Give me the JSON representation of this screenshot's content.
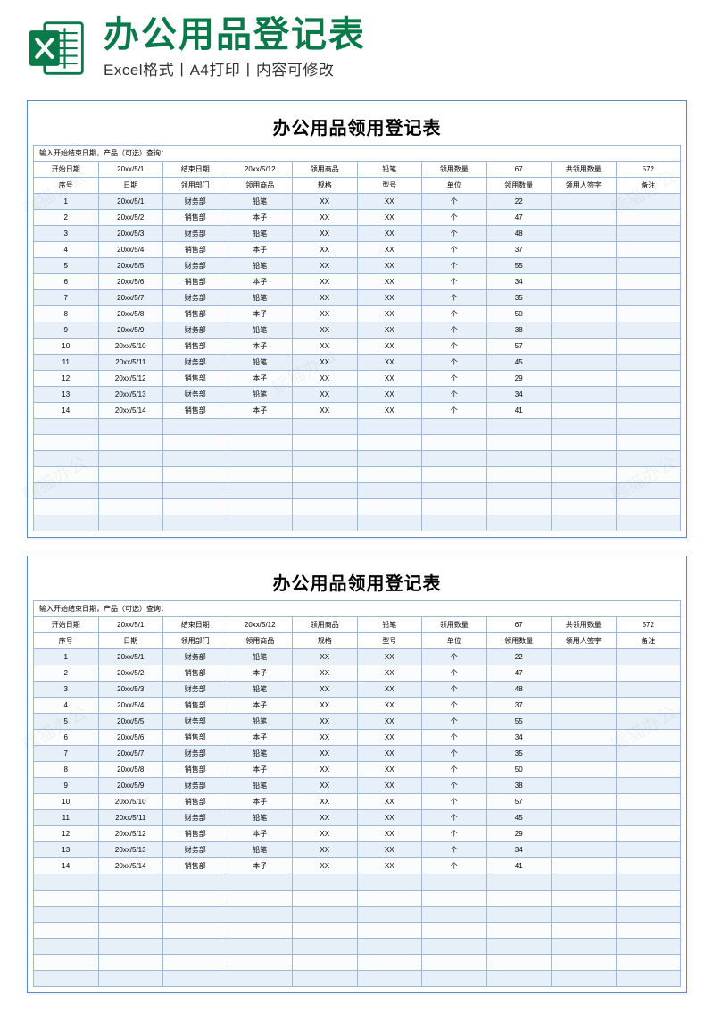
{
  "header": {
    "title": "办公用品登记表",
    "subtitle": "Excel格式丨A4打印丨内容可修改",
    "icon_name": "excel-icon"
  },
  "watermark": "熊猫办公",
  "doc": {
    "title": "办公用品领用登记表",
    "query_label": "输入开始结束日期，产品（可选）查询：",
    "filter": {
      "start_label": "开始日期",
      "start_val": "20xx/5/1",
      "end_label": "结束日期",
      "end_val": "20xx/5/12",
      "product_label": "领用商品",
      "product_val": "铅笔",
      "qty_label": "领用数量",
      "qty_val": "67",
      "total_label": "共领用数量",
      "total_val": "572"
    },
    "columns": [
      "序号",
      "日期",
      "领用部门",
      "领用商品",
      "规格",
      "型号",
      "单位",
      "领用数量",
      "领用人签字",
      "备注"
    ],
    "rows": [
      {
        "no": "1",
        "date": "20xx/5/1",
        "dept": "财务部",
        "item": "铅笔",
        "spec": "XX",
        "model": "XX",
        "unit": "个",
        "qty": "22",
        "sign": "",
        "note": ""
      },
      {
        "no": "2",
        "date": "20xx/5/2",
        "dept": "销售部",
        "item": "本子",
        "spec": "XX",
        "model": "XX",
        "unit": "个",
        "qty": "47",
        "sign": "",
        "note": ""
      },
      {
        "no": "3",
        "date": "20xx/5/3",
        "dept": "财务部",
        "item": "铅笔",
        "spec": "XX",
        "model": "XX",
        "unit": "个",
        "qty": "48",
        "sign": "",
        "note": ""
      },
      {
        "no": "4",
        "date": "20xx/5/4",
        "dept": "销售部",
        "item": "本子",
        "spec": "XX",
        "model": "XX",
        "unit": "个",
        "qty": "37",
        "sign": "",
        "note": ""
      },
      {
        "no": "5",
        "date": "20xx/5/5",
        "dept": "财务部",
        "item": "铅笔",
        "spec": "XX",
        "model": "XX",
        "unit": "个",
        "qty": "55",
        "sign": "",
        "note": ""
      },
      {
        "no": "6",
        "date": "20xx/5/6",
        "dept": "销售部",
        "item": "本子",
        "spec": "XX",
        "model": "XX",
        "unit": "个",
        "qty": "34",
        "sign": "",
        "note": ""
      },
      {
        "no": "7",
        "date": "20xx/5/7",
        "dept": "财务部",
        "item": "铅笔",
        "spec": "XX",
        "model": "XX",
        "unit": "个",
        "qty": "35",
        "sign": "",
        "note": ""
      },
      {
        "no": "8",
        "date": "20xx/5/8",
        "dept": "销售部",
        "item": "本子",
        "spec": "XX",
        "model": "XX",
        "unit": "个",
        "qty": "50",
        "sign": "",
        "note": ""
      },
      {
        "no": "9",
        "date": "20xx/5/9",
        "dept": "财务部",
        "item": "铅笔",
        "spec": "XX",
        "model": "XX",
        "unit": "个",
        "qty": "38",
        "sign": "",
        "note": ""
      },
      {
        "no": "10",
        "date": "20xx/5/10",
        "dept": "销售部",
        "item": "本子",
        "spec": "XX",
        "model": "XX",
        "unit": "个",
        "qty": "57",
        "sign": "",
        "note": ""
      },
      {
        "no": "11",
        "date": "20xx/5/11",
        "dept": "财务部",
        "item": "铅笔",
        "spec": "XX",
        "model": "XX",
        "unit": "个",
        "qty": "45",
        "sign": "",
        "note": ""
      },
      {
        "no": "12",
        "date": "20xx/5/12",
        "dept": "销售部",
        "item": "本子",
        "spec": "XX",
        "model": "XX",
        "unit": "个",
        "qty": "29",
        "sign": "",
        "note": ""
      },
      {
        "no": "13",
        "date": "20xx/5/13",
        "dept": "财务部",
        "item": "铅笔",
        "spec": "XX",
        "model": "XX",
        "unit": "个",
        "qty": "34",
        "sign": "",
        "note": ""
      },
      {
        "no": "14",
        "date": "20xx/5/14",
        "dept": "销售部",
        "item": "本子",
        "spec": "XX",
        "model": "XX",
        "unit": "个",
        "qty": "41",
        "sign": "",
        "note": ""
      }
    ],
    "empty_rows": 7
  }
}
